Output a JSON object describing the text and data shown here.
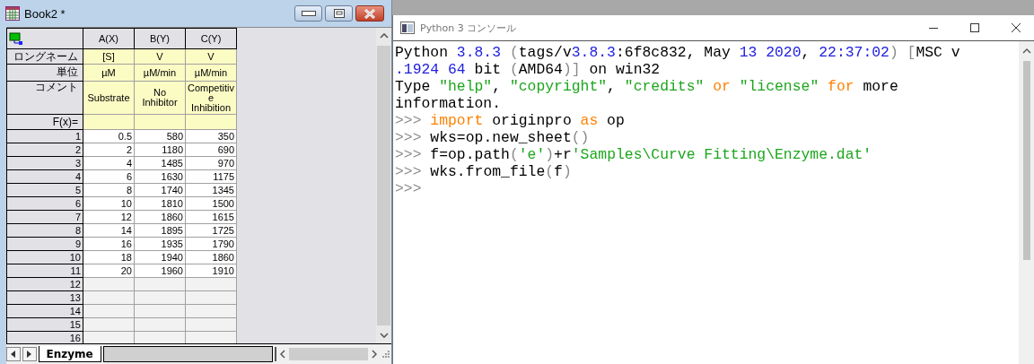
{
  "worksheet_window": {
    "title": "Book2 *",
    "columns": [
      {
        "header": "A(X)",
        "long_name": "[S]",
        "units": "µM",
        "comment": "Substrate"
      },
      {
        "header": "B(Y)",
        "long_name": "V",
        "units": "µM/min",
        "comment": "No Inhibitor"
      },
      {
        "header": "C(Y)",
        "long_name": "V",
        "units": "µM/min",
        "comment": "Competitive Inhibition"
      }
    ],
    "label_rows": [
      "ロングネーム",
      "単位",
      "コメント",
      "F(x)="
    ],
    "rows": [
      {
        "number": "1",
        "cells": [
          "0.5",
          "580",
          "350"
        ]
      },
      {
        "number": "2",
        "cells": [
          "2",
          "1180",
          "690"
        ]
      },
      {
        "number": "3",
        "cells": [
          "4",
          "1485",
          "970"
        ]
      },
      {
        "number": "4",
        "cells": [
          "6",
          "1630",
          "1175"
        ]
      },
      {
        "number": "5",
        "cells": [
          "8",
          "1740",
          "1345"
        ]
      },
      {
        "number": "6",
        "cells": [
          "10",
          "1810",
          "1500"
        ]
      },
      {
        "number": "7",
        "cells": [
          "12",
          "1860",
          "1615"
        ]
      },
      {
        "number": "8",
        "cells": [
          "14",
          "1895",
          "1725"
        ]
      },
      {
        "number": "9",
        "cells": [
          "16",
          "1935",
          "1790"
        ]
      },
      {
        "number": "10",
        "cells": [
          "18",
          "1940",
          "1860"
        ]
      },
      {
        "number": "11",
        "cells": [
          "20",
          "1960",
          "1910"
        ]
      },
      {
        "number": "12"
      },
      {
        "number": "13"
      },
      {
        "number": "14"
      },
      {
        "number": "15"
      },
      {
        "number": "16"
      }
    ],
    "sheet_tabs": [
      {
        "label": "Enzyme",
        "selected": true
      }
    ]
  },
  "console_window": {
    "title": "Python 3 コンソール",
    "lines": [
      [
        {
          "text": "Python ",
          "kind": "plain"
        },
        {
          "text": "3.8.3",
          "kind": "number"
        },
        {
          "text": " (",
          "kind": "dim"
        },
        {
          "text": "tags/v",
          "kind": "plain"
        },
        {
          "text": "3.8.3",
          "kind": "number"
        },
        {
          "text": ":6f8c832, May ",
          "kind": "plain"
        },
        {
          "text": "13 2020",
          "kind": "number"
        },
        {
          "text": ", ",
          "kind": "plain"
        },
        {
          "text": "22:37:02",
          "kind": "number"
        },
        {
          "text": ") [",
          "kind": "dim"
        },
        {
          "text": "MSC v",
          "kind": "plain"
        }
      ],
      [
        {
          "text": ".1924 64",
          "kind": "number"
        },
        {
          "text": " bit ",
          "kind": "plain"
        },
        {
          "text": "(",
          "kind": "dim"
        },
        {
          "text": "AMD64",
          "kind": "plain"
        },
        {
          "text": ")]",
          "kind": "dim"
        },
        {
          "text": " on win32",
          "kind": "plain"
        }
      ],
      [
        {
          "text": "Type ",
          "kind": "plain"
        },
        {
          "text": "\"help\"",
          "kind": "string"
        },
        {
          "text": ", ",
          "kind": "plain"
        },
        {
          "text": "\"copyright\"",
          "kind": "string"
        },
        {
          "text": ", ",
          "kind": "plain"
        },
        {
          "text": "\"credits\"",
          "kind": "string"
        },
        {
          "text": " or ",
          "kind": "keyword"
        },
        {
          "text": "\"license\"",
          "kind": "string"
        },
        {
          "text": " for",
          "kind": "keyword"
        },
        {
          "text": " more",
          "kind": "plain"
        }
      ],
      [
        {
          "text": "information.",
          "kind": "plain"
        }
      ],
      [
        {
          "text": ">>> ",
          "kind": "dim"
        },
        {
          "text": "import",
          "kind": "keyword"
        },
        {
          "text": " originpro ",
          "kind": "plain"
        },
        {
          "text": "as",
          "kind": "keyword"
        },
        {
          "text": " op",
          "kind": "plain"
        }
      ],
      [
        {
          "text": ">>> ",
          "kind": "dim"
        },
        {
          "text": "wks=op.new_sheet",
          "kind": "plain"
        },
        {
          "text": "()",
          "kind": "dim"
        }
      ],
      [
        {
          "text": ">>> ",
          "kind": "dim"
        },
        {
          "text": "f=op.path",
          "kind": "plain"
        },
        {
          "text": "(",
          "kind": "dim"
        },
        {
          "text": "'e'",
          "kind": "string"
        },
        {
          "text": ")",
          "kind": "dim"
        },
        {
          "text": "+r",
          "kind": "plain"
        },
        {
          "text": "'Samples\\Curve Fitting\\Enzyme.dat'",
          "kind": "string"
        }
      ],
      [
        {
          "text": ">>> ",
          "kind": "dim"
        },
        {
          "text": "wks.from_file",
          "kind": "plain"
        },
        {
          "text": "(",
          "kind": "dim"
        },
        {
          "text": "f",
          "kind": "plain"
        },
        {
          "text": ")",
          "kind": "dim"
        }
      ],
      [
        {
          "text": ">>>",
          "kind": "dim"
        }
      ]
    ]
  }
}
